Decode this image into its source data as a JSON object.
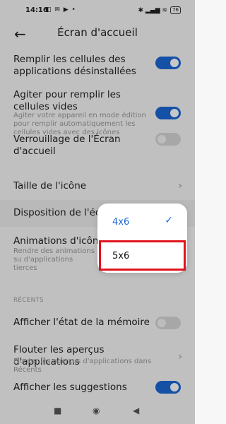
{
  "status_bar": {
    "time": "14:16",
    "left_icons": "◧ ✉ ▶ •",
    "right_icons": "✱ ▂▄▆ ≋",
    "battery": "76"
  },
  "header": {
    "title": "Écran d'accueil"
  },
  "settings": [
    {
      "label": "Remplir les cellules des applications désinstallées",
      "toggle": "on"
    },
    {
      "label": "Agiter pour remplir les cellules vides",
      "sub": "Agiter votre appareil en mode édition pour remplir automatiquement les cellules vides avec des icônes",
      "toggle": "on"
    },
    {
      "label": "Verrouillage de l'Écran d'accueil",
      "toggle": "off"
    },
    {
      "label": "Taille de l'icône",
      "chevron": "›"
    },
    {
      "label": "Disposition de l'écran"
    },
    {
      "label": "Animations d'icônes",
      "sub": "Rendre des animations su d'applications tierces"
    }
  ],
  "section_recents": "RÉCENTS",
  "recents": [
    {
      "label": "Afficher l'état de la mémoire",
      "toggle": "off"
    },
    {
      "label": "Flouter les aperçus d'applications",
      "sub": "Flouter les aperçus d'applications dans Récents",
      "chevron": "›"
    },
    {
      "label": "Afficher les suggestions",
      "toggle": "on"
    }
  ],
  "popup": {
    "options": [
      "4x6",
      "5x6"
    ],
    "selected": "4x6",
    "check_icon": "✓"
  },
  "nav": {
    "recents": "■",
    "home": "◉",
    "back": "◀"
  },
  "colors": {
    "accent": "#1b67d6",
    "highlight": "#e0141e"
  }
}
